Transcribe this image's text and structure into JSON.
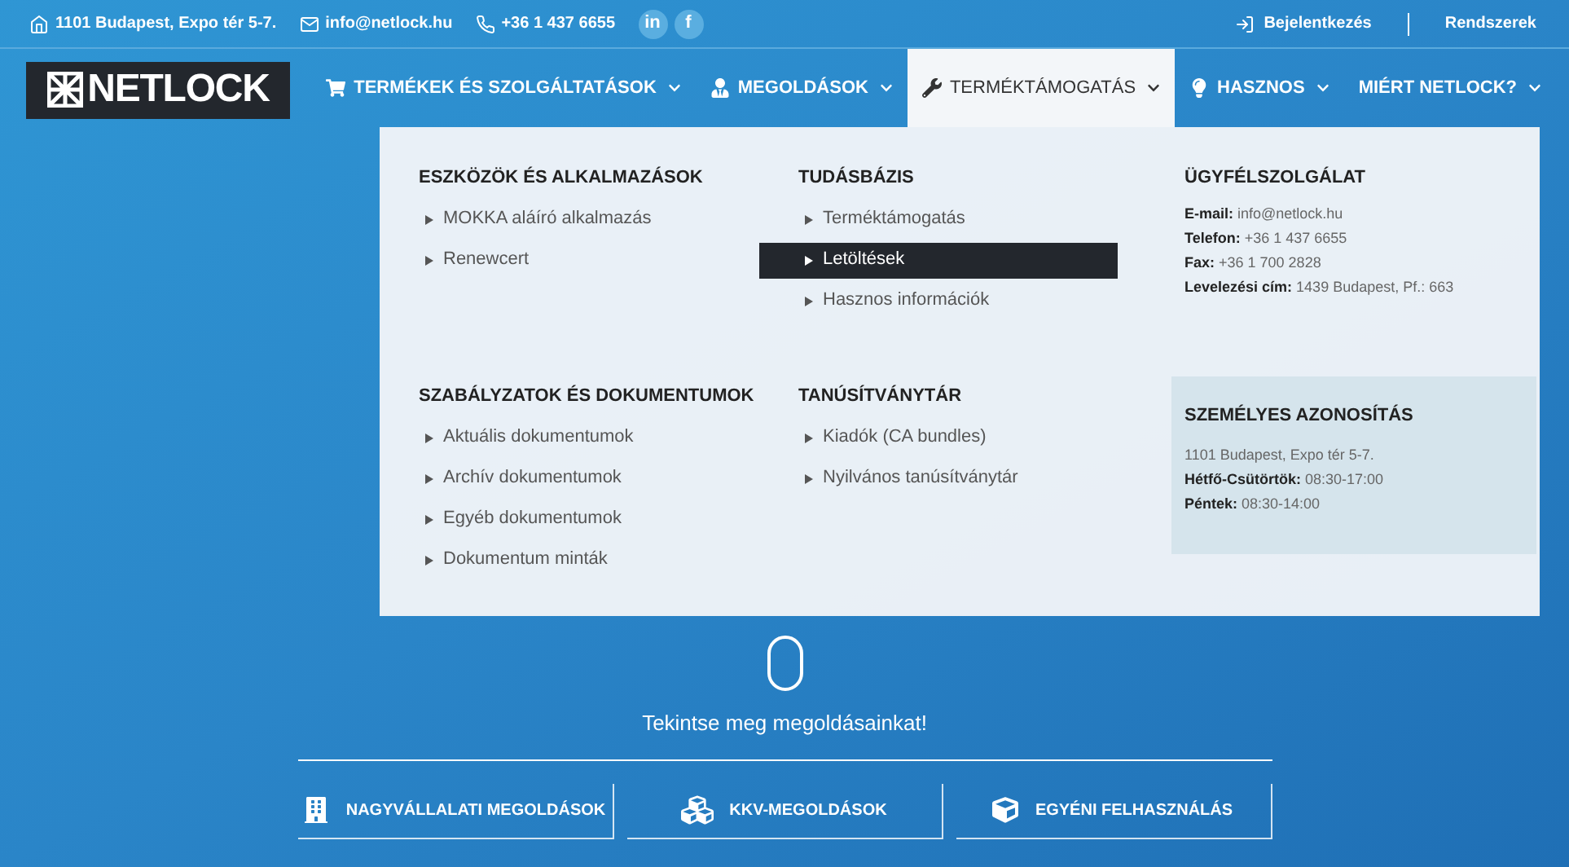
{
  "topbar": {
    "address": "1101 Budapest, Expo tér 5-7.",
    "email": "info@netlock.hu",
    "phone": "+36 1 437 6655",
    "social": [
      {
        "label": "in"
      },
      {
        "label": "f"
      }
    ],
    "login": "Bejelentkezés",
    "systems": "Rendszerek"
  },
  "logo": {
    "text": "NETLOCK"
  },
  "nav": [
    {
      "label": "TERMÉKEK ÉS SZOLGÁLTATÁSOK",
      "selected": false
    },
    {
      "label": "MEGOLDÁSOK",
      "selected": false
    },
    {
      "label": "TERMÉKTÁMOGATÁS",
      "selected": true
    },
    {
      "label": "HASZNOS",
      "selected": false
    },
    {
      "label": "MIÉRT NETLOCK?",
      "selected": false
    }
  ],
  "menu": {
    "sections": [
      {
        "title": "ESZKÖZÖK ÉS ALKALMAZÁSOK",
        "items": [
          {
            "label": "MOKKA aláíró alkalmazás",
            "selected": false
          },
          {
            "label": "Renewcert",
            "selected": false
          }
        ]
      },
      {
        "title": "TUDÁSBÁZIS",
        "items": [
          {
            "label": "Terméktámogatás",
            "selected": false
          },
          {
            "label": "Letöltések",
            "selected": true
          },
          {
            "label": "Hasznos információk",
            "selected": false
          }
        ]
      },
      {
        "title": "SZABÁLYZATOK ÉS DOKUMENTUMOK",
        "items": [
          {
            "label": "Aktuális dokumentumok",
            "selected": false
          },
          {
            "label": "Archív dokumentumok",
            "selected": false
          },
          {
            "label": "Egyéb dokumentumok",
            "selected": false
          },
          {
            "label": "Dokumentum minták",
            "selected": false
          }
        ]
      },
      {
        "title": "TANÚSÍTVÁNYTÁR",
        "items": [
          {
            "label": "Kiadók (CA bundles)",
            "selected": false
          },
          {
            "label": "Nyilvános tanúsítványtár",
            "selected": false
          }
        ]
      }
    ],
    "support": {
      "title": "ÜGYFÉLSZOLGÁLAT",
      "lines": [
        "**E-mail:** info@netlock.hu",
        "**Telefon:** +36 1 437 6655",
        "**Fax:** +36 1 700 2828",
        "**Levelezési cím:** 1439 Budapest, Pf.: 663"
      ]
    },
    "identity": {
      "title": "SZEMÉLYES AZONOSÍTÁS",
      "lines": [
        "1101 Budapest, Expo tér 5-7.",
        "**Hétfő-Csütörtök:** 08:30-17:00",
        "**Péntek:** 08:30-14:00"
      ]
    }
  },
  "hero": {
    "cta": "Tekintse meg megoldásainkat!",
    "buttons": [
      {
        "label": "NAGYVÁLLALATI MEGOLDÁSOK"
      },
      {
        "label": "KKV-MEGOLDÁSOK"
      },
      {
        "label": "EGYÉNI FELHASZNÁLÁS"
      }
    ]
  }
}
